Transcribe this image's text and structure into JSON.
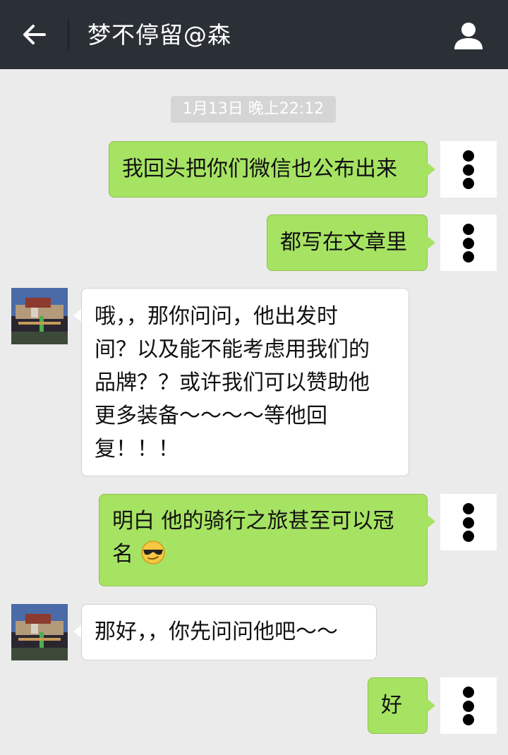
{
  "header": {
    "title": "梦不停留@森",
    "back_icon": "back-arrow-icon",
    "profile_icon": "person-icon"
  },
  "chat": {
    "timestamp": "1月13日 晚上22:12",
    "messages": [
      {
        "sender": "me",
        "text": "我回头把你们微信也公布出来"
      },
      {
        "sender": "me",
        "text": "都写在文章里"
      },
      {
        "sender": "them",
        "lines": [
          "哦，，那你问问，他出发时",
          "间？以及能不能考虑用我们的",
          "品牌？？或许我们可以赞助他",
          "更多装备～～～～等他回",
          "复！！！"
        ]
      },
      {
        "sender": "me",
        "lines": [
          "明白 他的骑行之旅甚至可以冠",
          "名"
        ],
        "emoji": "cool-sunglasses-emoji-icon"
      },
      {
        "sender": "them",
        "text": "那好，，你先问问他吧～～"
      },
      {
        "sender": "me",
        "text": "好"
      }
    ]
  },
  "colors": {
    "topbar": "#2b3036",
    "background": "#ebebeb",
    "my_bubble": "#a7e363",
    "their_bubble": "#ffffff"
  }
}
